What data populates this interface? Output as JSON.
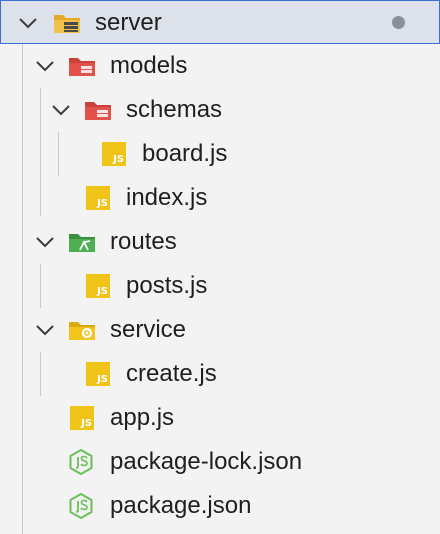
{
  "explorer": {
    "root": {
      "label": "server",
      "expanded": true,
      "selected": true,
      "status_dot_color": "#8a8f99",
      "icon": "folder-server-icon"
    },
    "items": [
      {
        "label": "models",
        "type": "folder",
        "expanded": true,
        "icon": "folder-models-icon"
      },
      {
        "label": "schemas",
        "type": "folder",
        "expanded": true,
        "icon": "folder-models-icon"
      },
      {
        "label": "board.js",
        "type": "file",
        "icon": "js-file-icon"
      },
      {
        "label": "index.js",
        "type": "file",
        "icon": "js-file-icon"
      },
      {
        "label": "routes",
        "type": "folder",
        "expanded": true,
        "icon": "folder-routes-icon"
      },
      {
        "label": "posts.js",
        "type": "file",
        "icon": "js-file-icon"
      },
      {
        "label": "service",
        "type": "folder",
        "expanded": true,
        "icon": "folder-service-icon"
      },
      {
        "label": "create.js",
        "type": "file",
        "icon": "js-file-icon"
      },
      {
        "label": "app.js",
        "type": "file",
        "icon": "js-file-icon"
      },
      {
        "label": "package-lock.json",
        "type": "file",
        "icon": "nodejs-icon"
      },
      {
        "label": "package.json",
        "type": "file",
        "icon": "nodejs-icon"
      }
    ]
  },
  "icon_text": {
    "js": "JS"
  },
  "colors": {
    "js_yellow": "#f0c419",
    "models_red": "#e0524a",
    "routes_green": "#4caf50",
    "service_yellow": "#f2c41c",
    "server_folder": "#e6a82a",
    "node_green": "#6cbf5a",
    "selection_border": "#3a6fd0"
  }
}
